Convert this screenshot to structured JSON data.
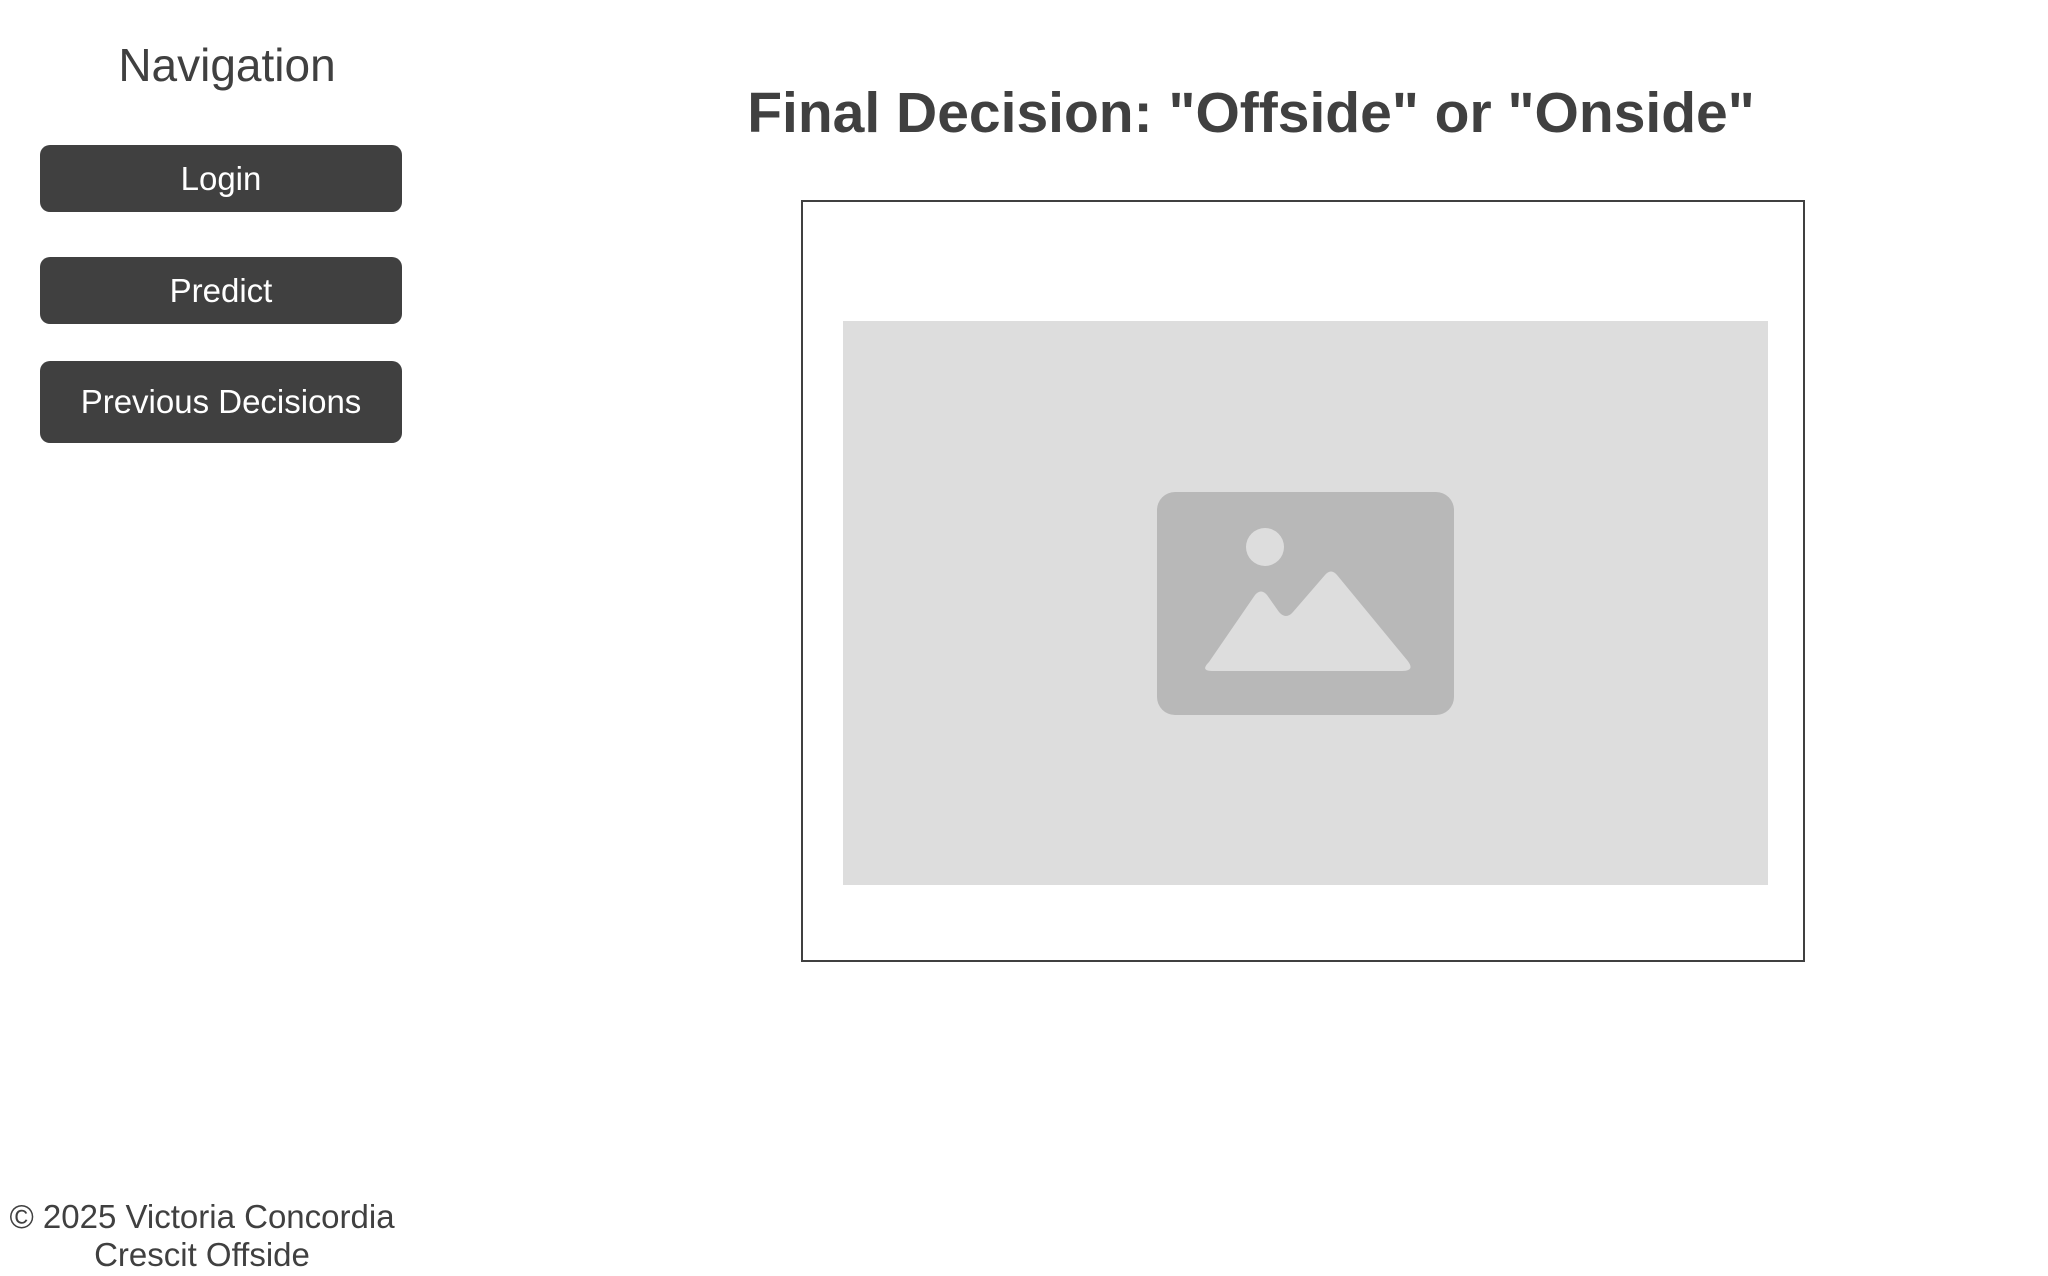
{
  "sidebar": {
    "title": "Navigation",
    "buttons": [
      {
        "label": "Login"
      },
      {
        "label": "Predict"
      },
      {
        "label": "Previous Decisions"
      }
    ]
  },
  "main": {
    "title": "Final Decision: \"Offside\" or \"Onside\"",
    "image": {
      "icon": "image-placeholder-icon"
    }
  },
  "footer": {
    "line1": "© 2025 Victoria Concordia",
    "line2": "Crescit Offside"
  },
  "colors": {
    "dark": "#404040",
    "placeholder_bg": "#dddddd",
    "placeholder_icon": "#b8b8b8"
  }
}
